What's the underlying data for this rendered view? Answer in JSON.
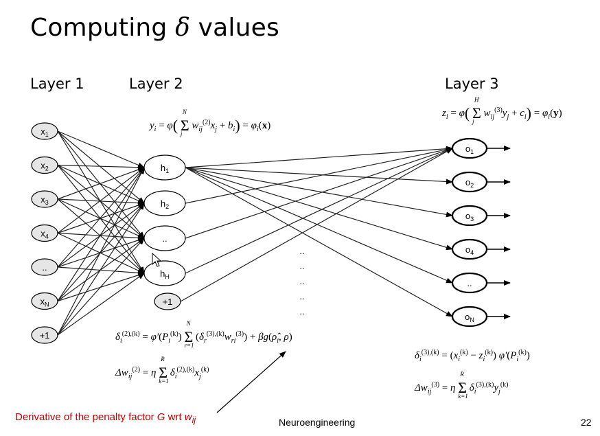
{
  "title": {
    "prefix": "Computing",
    "symbol": "δ",
    "suffix": "values"
  },
  "layers": [
    {
      "label": "Layer 1",
      "nodes": [
        {
          "base": "x",
          "sub": "1"
        },
        {
          "base": "x",
          "sub": "2"
        },
        {
          "base": "x",
          "sub": "3"
        },
        {
          "base": "x",
          "sub": "4"
        },
        {
          "base": "..",
          "sub": ""
        },
        {
          "base": "x",
          "sub": "N"
        },
        {
          "base": "+1",
          "sub": ""
        }
      ]
    },
    {
      "label": "Layer 2",
      "nodes": [
        {
          "base": "h",
          "sub": "1"
        },
        {
          "base": "h",
          "sub": "2"
        },
        {
          "base": "..",
          "sub": ""
        },
        {
          "base": "h",
          "sub": "H"
        },
        {
          "base": "+1",
          "sub": ""
        }
      ]
    },
    {
      "label": "Layer 3",
      "nodes": [
        {
          "base": "o",
          "sub": "1"
        },
        {
          "base": "o",
          "sub": "2"
        },
        {
          "base": "o",
          "sub": "3"
        },
        {
          "base": "o",
          "sub": "4"
        },
        {
          "base": "..",
          "sub": ""
        },
        {
          "base": "o",
          "sub": "N"
        }
      ]
    }
  ],
  "middle_dots": [
    "..",
    "..",
    "..",
    "..",
    ".."
  ],
  "equations": {
    "hidden_output": "y_i = φ( Σ_j^N w_ij^(2) x_j + b_i ) = φ_i(x)",
    "output_output": "z_i = φ( Σ_j^H w_ij^(3) y_j + c_i ) = φ_i(y)",
    "hidden_delta": "δ_i^(2),(k) = φ'(P_i^(k)) Σ_(r=1)^N (δ_r^(3),(k) w_ri^(3)) + βg(ρ̂_i, ρ)",
    "hidden_update": "Δw_ij^(2) = η Σ_(k=1)^R δ_i^(2),(k) x_j^(k)",
    "output_delta": "δ_i^(3),(k) = (x_i^(k) − z_i^(k)) φ'(P_i^(k))",
    "output_update": "Δw_ij^(3) = η Σ_(k=1)^R δ_i^(3),(k) y_j^(k)"
  },
  "annotation": {
    "text": "Derivative of the penalty factor ",
    "var": "G",
    "mid": " wrt ",
    "w": "w",
    "wsub": "ij",
    "color": "#c00000"
  },
  "footer": "Neuroengineering",
  "page_number": "22"
}
